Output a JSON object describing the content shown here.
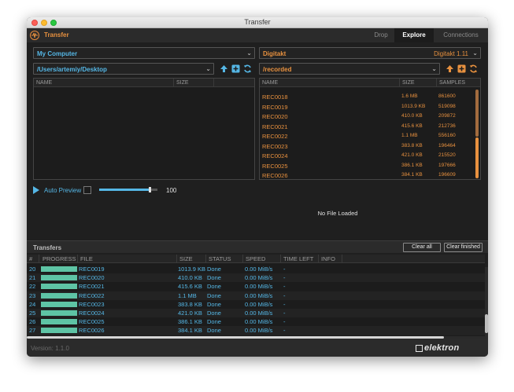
{
  "window": {
    "title": "Transfer"
  },
  "app": {
    "name": "Transfer",
    "icon": "waveform-icon"
  },
  "tabs": [
    {
      "label": "Drop",
      "active": false
    },
    {
      "label": "Explore",
      "active": true
    },
    {
      "label": "Connections",
      "active": false
    }
  ],
  "local": {
    "device": "My Computer",
    "path": "/Users/artemiy/Desktop",
    "columns": [
      "NAME",
      "SIZE"
    ],
    "files": []
  },
  "remote": {
    "device": "Digitakt",
    "device_version": "Digitakt 1.11",
    "path": "/recorded",
    "columns": [
      "NAME",
      "SIZE",
      "SAMPLES"
    ],
    "files": [
      {
        "name": "REC0018",
        "size": "1.6 MB",
        "samples": "861600"
      },
      {
        "name": "REC0019",
        "size": "1013.9 KB",
        "samples": "519098"
      },
      {
        "name": "REC0020",
        "size": "410.0 KB",
        "samples": "209872"
      },
      {
        "name": "REC0021",
        "size": "415.6 KB",
        "samples": "212736"
      },
      {
        "name": "REC0022",
        "size": "1.1 MB",
        "samples": "556160"
      },
      {
        "name": "REC0023",
        "size": "383.8 KB",
        "samples": "196464"
      },
      {
        "name": "REC0024",
        "size": "421.0 KB",
        "samples": "215520"
      },
      {
        "name": "REC0025",
        "size": "386.1 KB",
        "samples": "197666"
      },
      {
        "name": "REC0026",
        "size": "384.1 KB",
        "samples": "196609"
      }
    ]
  },
  "preview": {
    "label": "Auto Preview",
    "volume_value": "100",
    "volume_fraction": 0.86,
    "status": "No File Loaded"
  },
  "transfers": {
    "title": "Transfers",
    "clear_all": "Clear all",
    "clear_finished": "Clear finished",
    "columns": [
      "#",
      "PROGRESS",
      "FILE",
      "SIZE",
      "STATUS",
      "SPEED",
      "TIME LEFT",
      "INFO"
    ],
    "rows": [
      {
        "num": "20",
        "progress": 1.0,
        "file": "REC0019",
        "size": "1013.9 KB",
        "status": "Done",
        "speed": "0.00 MiB/s",
        "time_left": "-"
      },
      {
        "num": "21",
        "progress": 1.0,
        "file": "REC0020",
        "size": "410.0 KB",
        "status": "Done",
        "speed": "0.00 MiB/s",
        "time_left": "-"
      },
      {
        "num": "22",
        "progress": 1.0,
        "file": "REC0021",
        "size": "415.6 KB",
        "status": "Done",
        "speed": "0.00 MiB/s",
        "time_left": "-"
      },
      {
        "num": "23",
        "progress": 1.0,
        "file": "REC0022",
        "size": "1.1 MB",
        "status": "Done",
        "speed": "0.00 MiB/s",
        "time_left": "-"
      },
      {
        "num": "24",
        "progress": 1.0,
        "file": "REC0023",
        "size": "383.8 KB",
        "status": "Done",
        "speed": "0.00 MiB/s",
        "time_left": "-"
      },
      {
        "num": "25",
        "progress": 1.0,
        "file": "REC0024",
        "size": "421.0 KB",
        "status": "Done",
        "speed": "0.00 MiB/s",
        "time_left": "-"
      },
      {
        "num": "26",
        "progress": 1.0,
        "file": "REC0025",
        "size": "386.1 KB",
        "status": "Done",
        "speed": "0.00 MiB/s",
        "time_left": "-"
      },
      {
        "num": "27",
        "progress": 1.0,
        "file": "REC0026",
        "size": "384.1 KB",
        "status": "Done",
        "speed": "0.00 MiB/s",
        "time_left": "-"
      }
    ]
  },
  "footer": {
    "version": "Version: 1.1.0",
    "brand": "elektron"
  },
  "colors": {
    "accent_orange": "#e8913f",
    "accent_blue": "#55b7e6",
    "progress_green": "#5ec4a5",
    "background": "#1f1f1f"
  }
}
